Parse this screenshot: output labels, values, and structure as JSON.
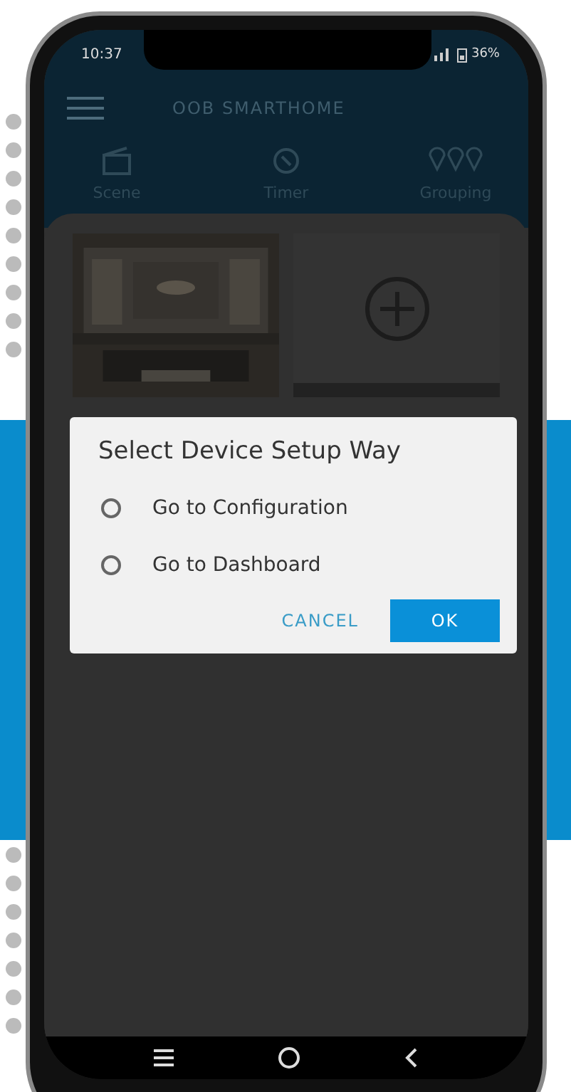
{
  "status_bar": {
    "time": "10:37",
    "battery": "36%"
  },
  "app_bar": {
    "brand": "OOB SMARTHOME"
  },
  "tabs": [
    {
      "label": "Scene",
      "selected": false
    },
    {
      "label": "Timer",
      "selected": false
    },
    {
      "label": "Grouping",
      "selected": false
    }
  ],
  "cards": [
    {
      "kind": "picture"
    },
    {
      "kind": "add"
    }
  ],
  "dialog": {
    "title": "Select Device Setup Way",
    "options": [
      {
        "label": "Go to Configuration",
        "selected": false
      },
      {
        "label": "Go to Dashboard",
        "selected": false
      }
    ],
    "buttons": [
      {
        "label": "CANCEL",
        "kind": "text"
      },
      {
        "label": "OK",
        "kind": "primary"
      }
    ]
  }
}
